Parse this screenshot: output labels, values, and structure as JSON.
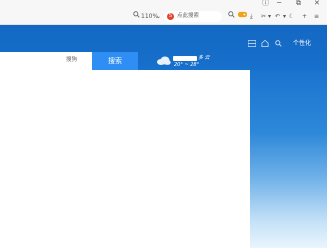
{
  "window": {
    "controls": [
      "ⓘ",
      "─",
      "⧉",
      "✕"
    ]
  },
  "toolbar": {
    "zoom": "110%",
    "search_placeholder": "点此搜索",
    "icons": [
      "zoom-icon",
      "chevron-down-icon",
      "search-engine-logo",
      "search-icon",
      "game-icon",
      "download-icon",
      "scissors-icon",
      "undo-icon",
      "moon-icon",
      "plus-icon",
      "menu-icon"
    ]
  },
  "header": {
    "personalize": "个性化",
    "icons": [
      "grid-icon",
      "home-icon",
      "search-icon"
    ]
  },
  "search": {
    "engine": "搜狗",
    "button": "搜索"
  },
  "weather": {
    "qualifier": "多 云",
    "range": "20° ~ 28°"
  }
}
